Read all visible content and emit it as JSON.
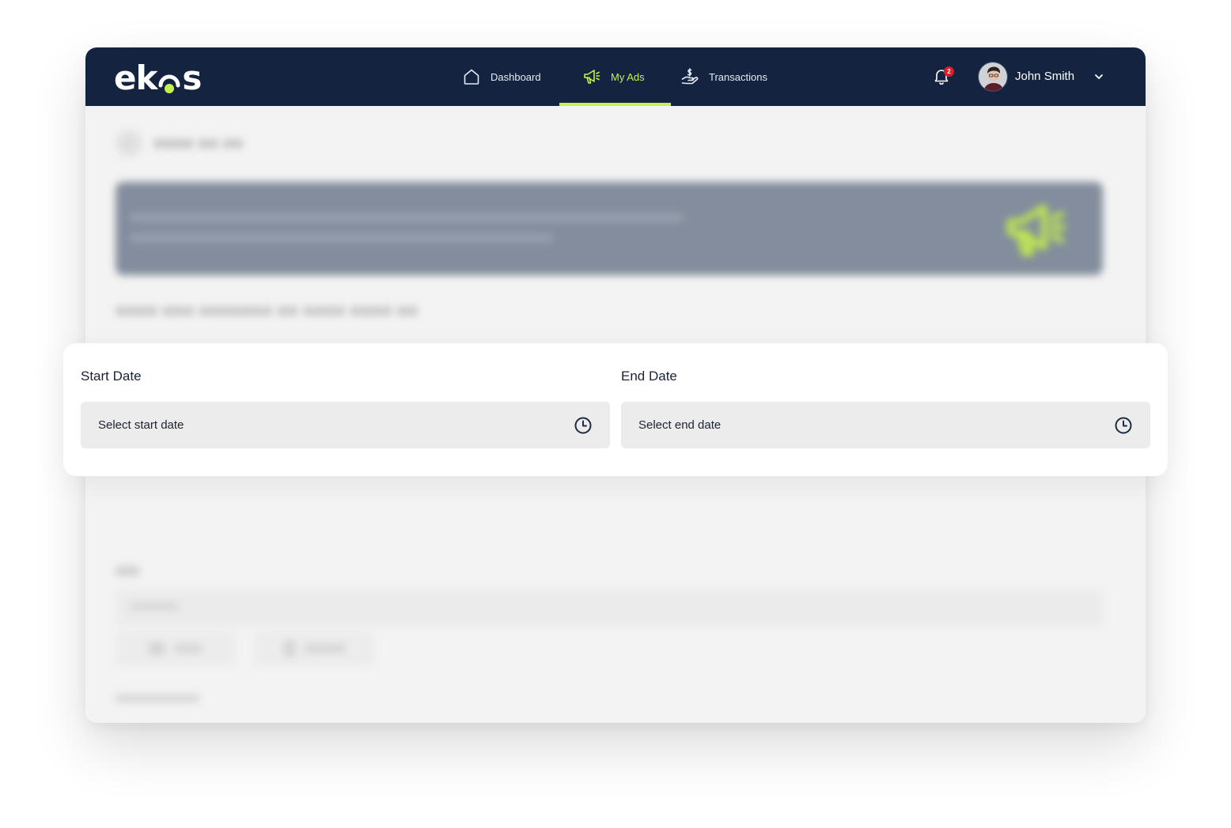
{
  "brand": {
    "name": "ekos",
    "accent": "#c6f04a",
    "navbar_bg": "#142440"
  },
  "nav": {
    "items": [
      {
        "label": "Dashboard",
        "icon": "home-icon"
      },
      {
        "label": "My Ads",
        "icon": "megaphone-icon",
        "active": true
      },
      {
        "label": "Transactions",
        "icon": "hand-dollar-icon"
      }
    ]
  },
  "notifications": {
    "count": "2",
    "icon": "bell-icon",
    "badge_color": "#e01b24"
  },
  "user": {
    "name": "John Smith",
    "icon": "chevron-down-icon"
  },
  "date_picker": {
    "start": {
      "label": "Start Date",
      "placeholder": "Select start date",
      "icon": "clock-icon"
    },
    "end": {
      "label": "End Date",
      "placeholder": "Select end date",
      "icon": "clock-icon"
    }
  }
}
